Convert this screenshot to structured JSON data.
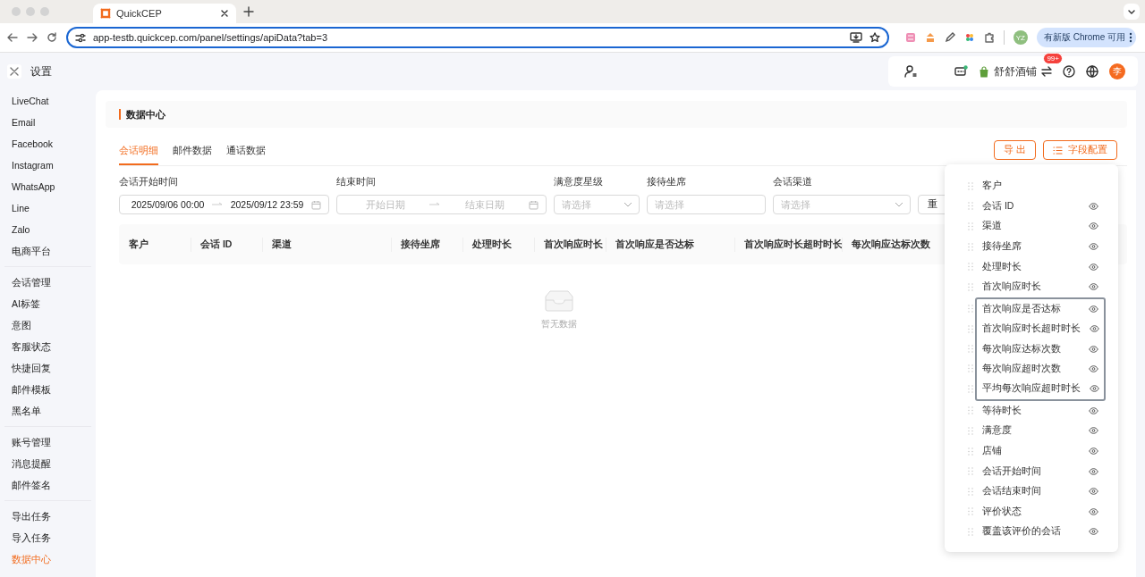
{
  "browser": {
    "tab_title": "QuickCEP",
    "url": "app-testb.quickcep.com/panel/settings/apiData?tab=3",
    "profile": "YZ",
    "update_button": "有新版 Chrome 可用"
  },
  "header": {
    "title": "设置",
    "shop": "舒舒酒铺",
    "notification_badge": "99+",
    "avatar": "李"
  },
  "sidebar": {
    "groups": [
      {
        "items": [
          {
            "label": "LiveChat",
            "selected": false
          },
          {
            "label": "Email",
            "selected": false
          },
          {
            "label": "Facebook",
            "selected": false
          },
          {
            "label": "Instagram",
            "selected": false
          },
          {
            "label": "WhatsApp",
            "selected": false
          },
          {
            "label": "Line",
            "selected": false
          },
          {
            "label": "Zalo",
            "selected": false
          },
          {
            "label": "电商平台",
            "selected": false
          }
        ]
      },
      {
        "items": [
          {
            "label": "会话管理",
            "selected": false
          },
          {
            "label": "AI标签",
            "selected": false
          },
          {
            "label": "意图",
            "selected": false
          },
          {
            "label": "客服状态",
            "selected": false
          },
          {
            "label": "快捷回复",
            "selected": false
          },
          {
            "label": "邮件模板",
            "selected": false
          },
          {
            "label": "黑名单",
            "selected": false
          }
        ]
      },
      {
        "items": [
          {
            "label": "账号管理",
            "selected": false
          },
          {
            "label": "消息提醒",
            "selected": false
          },
          {
            "label": "邮件签名",
            "selected": false
          }
        ]
      },
      {
        "items": [
          {
            "label": "导出任务",
            "selected": false
          },
          {
            "label": "导入任务",
            "selected": false
          },
          {
            "label": "数据中心",
            "selected": true
          }
        ]
      }
    ]
  },
  "page": {
    "title": "数据中心",
    "tabs": [
      {
        "label": "会话明细",
        "selected": true
      },
      {
        "label": "邮件数据",
        "selected": false
      },
      {
        "label": "通话数据",
        "selected": false
      }
    ],
    "buttons": [
      {
        "label": "导 出",
        "kind": "plain"
      },
      {
        "label": "字段配置",
        "kind": "list"
      }
    ],
    "filters": [
      {
        "label": "会话开始时间",
        "kind": "range",
        "start": "2025/09/06 00:00",
        "end": "2025/09/12 23:59"
      },
      {
        "label": "结束时间",
        "kind": "range",
        "start_placeholder": "开始日期",
        "end_placeholder": "结束日期"
      },
      {
        "label": "满意度星级",
        "kind": "select",
        "placeholder": "请选择"
      },
      {
        "label": "接待坐席",
        "kind": "input",
        "placeholder": "请选择"
      },
      {
        "label": "会话渠道",
        "kind": "select",
        "placeholder": "请选择"
      }
    ],
    "reset_button": "重",
    "table": {
      "columns": [
        "客户",
        "会话 ID",
        "渠道",
        "接待坐席",
        "处理时长",
        "首次响应时长",
        "首次响应是否达标",
        "首次响应时长超时时长",
        "每次响应达标次数"
      ],
      "empty_text": "暂无数据"
    }
  },
  "field_config": {
    "items": [
      {
        "label": "客户",
        "toggle": false,
        "highlighted": false
      },
      {
        "label": "会话 ID",
        "toggle": true,
        "highlighted": false
      },
      {
        "label": "渠道",
        "toggle": true,
        "highlighted": false
      },
      {
        "label": "接待坐席",
        "toggle": true,
        "highlighted": false
      },
      {
        "label": "处理时长",
        "toggle": true,
        "highlighted": false
      },
      {
        "label": "首次响应时长",
        "toggle": true,
        "highlighted": false
      },
      {
        "label": "首次响应是否达标",
        "toggle": true,
        "highlighted": true
      },
      {
        "label": "首次响应时长超时时长",
        "toggle": true,
        "highlighted": true
      },
      {
        "label": "每次响应达标次数",
        "toggle": true,
        "highlighted": true
      },
      {
        "label": "每次响应超时次数",
        "toggle": true,
        "highlighted": true
      },
      {
        "label": "平均每次响应超时时长",
        "toggle": true,
        "highlighted": true
      },
      {
        "label": "等待时长",
        "toggle": true,
        "highlighted": false
      },
      {
        "label": "满意度",
        "toggle": true,
        "highlighted": false
      },
      {
        "label": "店铺",
        "toggle": true,
        "highlighted": false
      },
      {
        "label": "会话开始时间",
        "toggle": true,
        "highlighted": false
      },
      {
        "label": "会话结束时间",
        "toggle": true,
        "highlighted": false
      },
      {
        "label": "评价状态",
        "toggle": true,
        "highlighted": false
      },
      {
        "label": "覆盖该评价的会话",
        "toggle": true,
        "highlighted": false
      }
    ]
  }
}
